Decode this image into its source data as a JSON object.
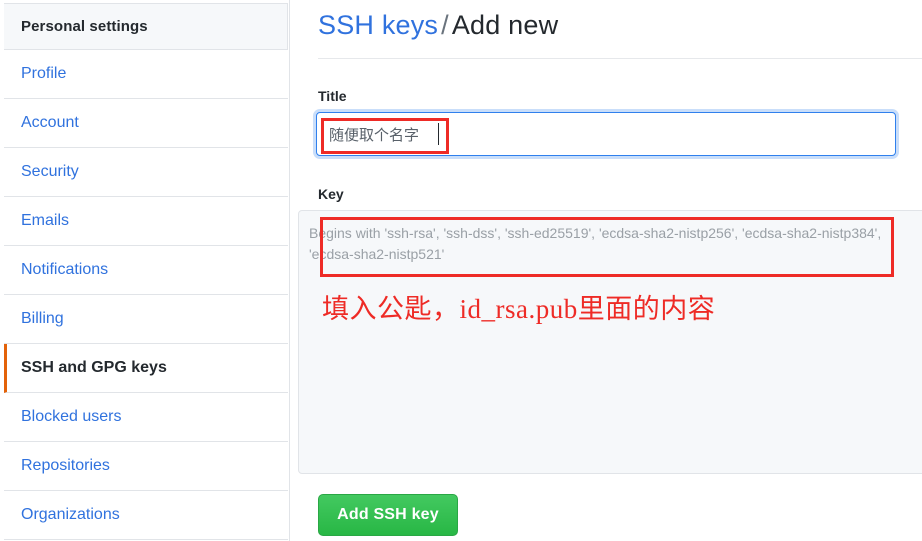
{
  "sidebar": {
    "header": "Personal settings",
    "items": [
      {
        "label": "Profile",
        "active": false
      },
      {
        "label": "Account",
        "active": false
      },
      {
        "label": "Security",
        "active": false
      },
      {
        "label": "Emails",
        "active": false
      },
      {
        "label": "Notifications",
        "active": false
      },
      {
        "label": "Billing",
        "active": false
      },
      {
        "label": "SSH and GPG keys",
        "active": true
      },
      {
        "label": "Blocked users",
        "active": false
      },
      {
        "label": "Repositories",
        "active": false
      },
      {
        "label": "Organizations",
        "active": false
      }
    ],
    "active_accent_color": "#e36209",
    "link_color": "#3072de"
  },
  "header": {
    "breadcrumb_link": "SSH keys",
    "breadcrumb_separator": "/",
    "breadcrumb_current": "Add new"
  },
  "form": {
    "title_label": "Title",
    "title_value": "随便取个名字",
    "title_placeholder": "",
    "key_label": "Key",
    "key_value": "",
    "key_placeholder": "Begins with 'ssh-rsa', 'ssh-dss', 'ssh-ed25519', 'ecdsa-sha2-nistp256', 'ecdsa-sha2-nistp384', 'ecdsa-sha2-nistp521'",
    "submit_label": "Add SSH key",
    "submit_color": "#28b745",
    "focus_border_color": "#2f80ed"
  },
  "annotations": {
    "color": "#ee2b26",
    "note_text": "填入公匙，id_rsa.pub里面的内容",
    "box_title_name": "title-field-highlight",
    "box_key_name": "key-field-highlight"
  }
}
